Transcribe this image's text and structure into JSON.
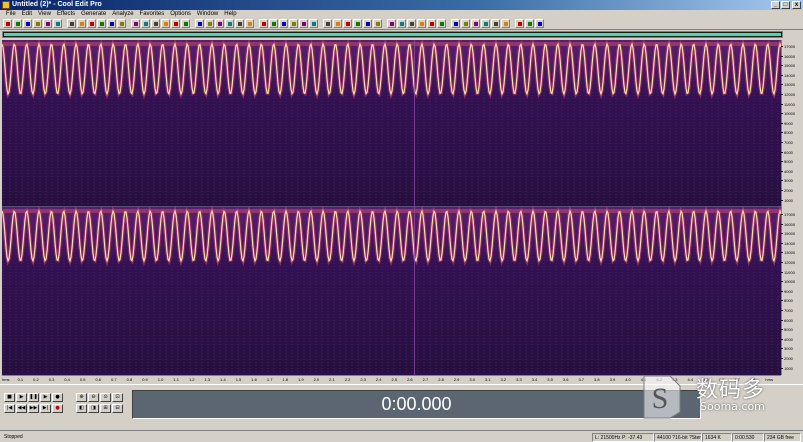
{
  "window": {
    "title": "Untitled (2)* - Cool Edit Pro"
  },
  "menu": [
    "File",
    "Edit",
    "View",
    "Effects",
    "Generate",
    "Analyze",
    "Favorites",
    "Options",
    "Window",
    "Help"
  ],
  "toolbar": {
    "icons": [
      "new-file",
      "open-file",
      "save-file",
      "cut",
      "copy",
      "paste",
      "undo",
      "redo",
      "zoom-in",
      "zoom-out",
      "spectral-view",
      "waveform-view",
      "multitrack-view",
      "select-tool",
      "hand-tool",
      "marker",
      "loop",
      "mix",
      "record-settings",
      "cd-tool",
      "meter",
      "eq",
      "effect-1",
      "effect-2",
      "effect-3",
      "effect-4",
      "effect-5",
      "effect-6",
      "effect-7",
      "effect-8",
      "effect-9",
      "effect-10",
      "effect-11",
      "effect-12",
      "effect-13",
      "effect-14",
      "effect-15",
      "effect-16",
      "effect-17",
      "effect-18",
      "effect-19",
      "effect-20",
      "effect-21",
      "effect-22",
      "effect-23",
      "effect-24",
      "effect-25",
      "effect-26",
      "effect-27",
      "effect-28",
      "effect-29"
    ]
  },
  "frequency_ruler": [
    "17000",
    "16000",
    "15000",
    "14000",
    "13000",
    "12000",
    "11000",
    "10000",
    "9000",
    "8000",
    "7000",
    "6000",
    "5000",
    "4000",
    "3000",
    "2000",
    "1000",
    "17000",
    "16000",
    "15000",
    "14000",
    "13000",
    "12000",
    "11000",
    "10000",
    "9000",
    "8000",
    "7000",
    "6000",
    "5000",
    "4000",
    "3000",
    "2000",
    "1000"
  ],
  "time_ruler": [
    "hms",
    "0.1",
    "0.2",
    "0.3",
    "0.4",
    "0.5",
    "0.6",
    "0.7",
    "0.8",
    "0.9",
    "1.0",
    "1.1",
    "1.2",
    "1.3",
    "1.4",
    "1.5",
    "1.6",
    "1.7",
    "1.8",
    "1.9",
    "2.0",
    "2.1",
    "2.2",
    "2.3",
    "2.4",
    "2.5",
    "2.6",
    "2.7",
    "2.8",
    "2.9",
    "3.0",
    "3.1",
    "3.2",
    "3.3",
    "3.4",
    "3.5",
    "3.6",
    "3.7",
    "3.8",
    "3.9",
    "4.0",
    "4.1",
    "4.2",
    "4.3",
    "4.4",
    "4.5",
    "4.6",
    "4.7",
    "4.8",
    "hms"
  ],
  "transport": {
    "row1": [
      "■",
      "▶",
      "❚❚",
      "▶",
      "●"
    ],
    "row2": [
      "|◀",
      "◀◀",
      "▶▶",
      "▶|",
      "●"
    ],
    "time": "0:00.000"
  },
  "watermark": {
    "text": "数码多",
    "sub": "Sooma.com"
  },
  "status": {
    "left": "Stopped",
    "cells": [
      "L: 21500Hz  P: -37.43",
      "44100 ?16-bit ?Stereo",
      "1634 K",
      "0:00.530",
      "234 GB free"
    ]
  },
  "colors": {
    "spectral_bg": "#2b0f4e",
    "curve": "#ffe0a8",
    "overview": "#4dd9a6"
  }
}
